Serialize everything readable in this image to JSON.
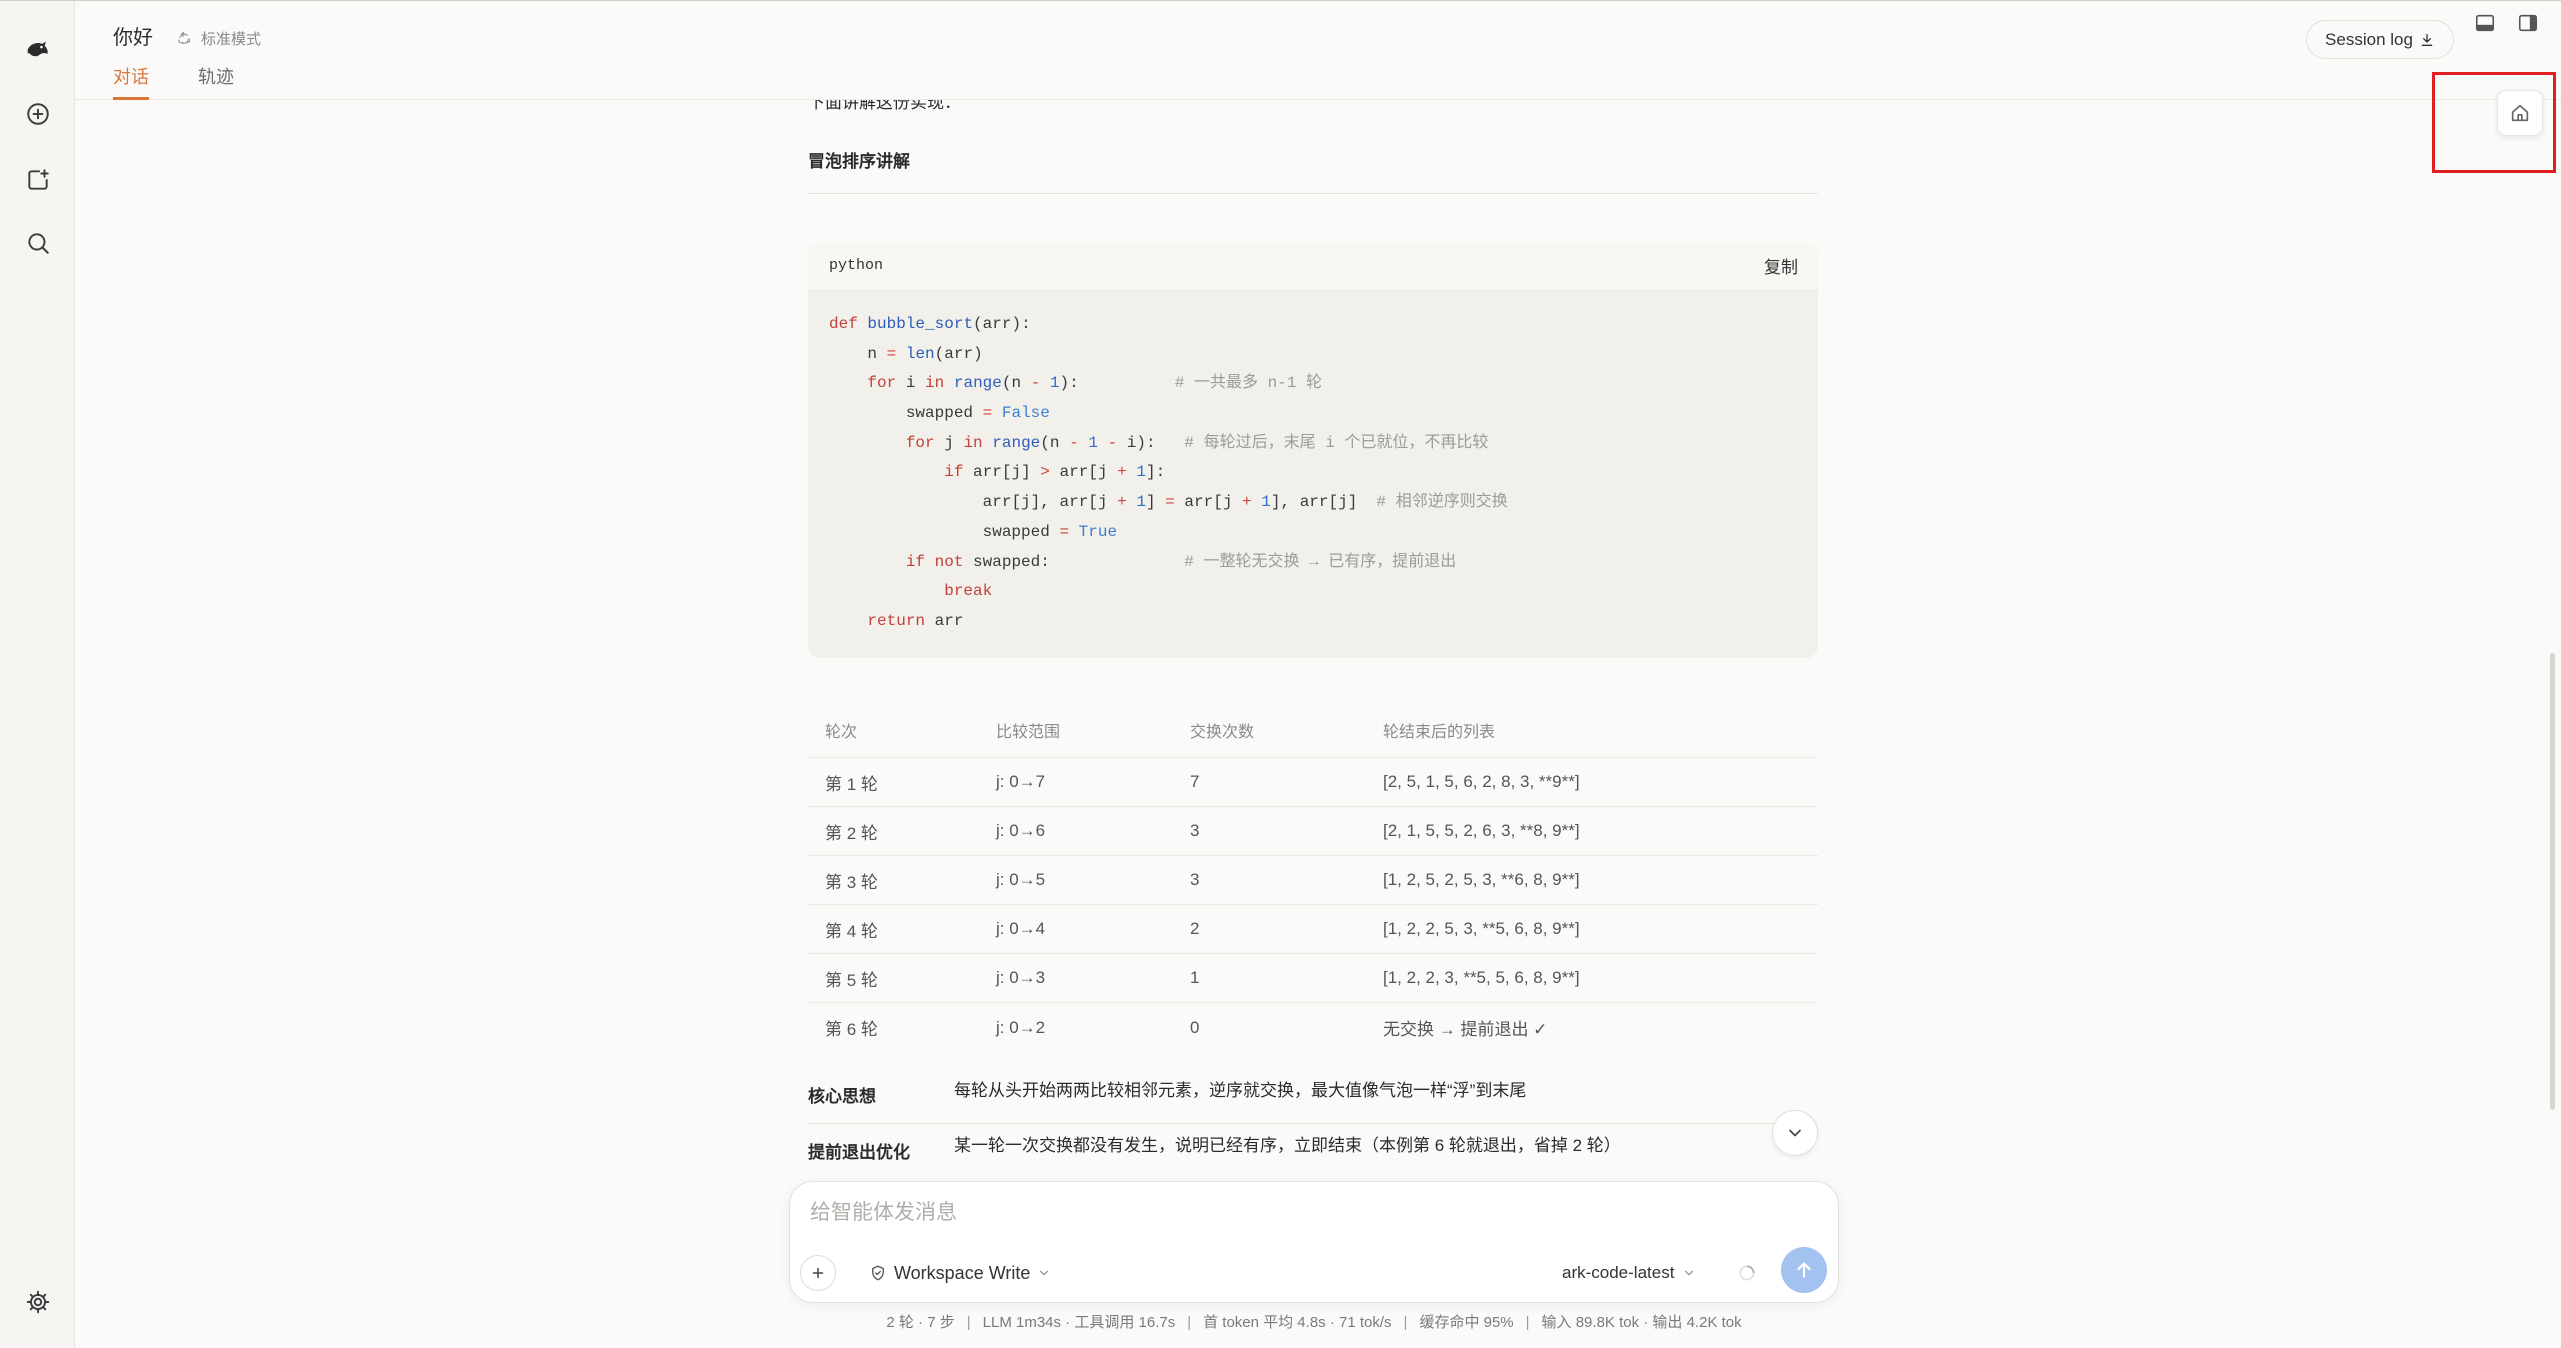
{
  "colors": {
    "accent": "#d9773b",
    "page_bg": "#fbfaf8",
    "sidebar_bg": "#f6f5f2",
    "code_bg": "#f2f0eb",
    "highlight_box": "#e02020",
    "send_button": "#a3c2f0"
  },
  "sidebar": {
    "icons": [
      "app-logo-icon",
      "plus-circle-icon",
      "new-project-icon",
      "search-icon",
      "settings-gear-icon"
    ]
  },
  "header": {
    "title": "你好",
    "mode_icon": "recycle-icon",
    "mode": "标准模式",
    "tabs": [
      {
        "label": "对话",
        "active": true
      },
      {
        "label": "轨迹",
        "active": false
      }
    ],
    "session_log": {
      "label": "Session log",
      "icon": "download-icon"
    },
    "layout_icons": [
      "panel-bottom-icon",
      "panel-right-icon"
    ]
  },
  "floating": {
    "home_icon": "home-icon",
    "scroll_down_icon": "chevron-down-icon"
  },
  "content": {
    "intro": "下面讲解这份实现：",
    "heading": "冒泡排序讲解",
    "code": {
      "language": "python",
      "copy_label": "复制",
      "lines": [
        "def bubble_sort(arr):",
        "    n = len(arr)",
        "    for i in range(n - 1):          # 一共最多 n-1 轮",
        "        swapped = False",
        "        for j in range(n - 1 - i):   # 每轮过后，末尾 i 个已就位，不再比较",
        "            if arr[j] > arr[j + 1]:",
        "                arr[j], arr[j + 1] = arr[j + 1], arr[j]  # 相邻逆序则交换",
        "                swapped = True",
        "        if not swapped:              # 一整轮无交换 → 已有序，提前退出",
        "            break",
        "    return arr"
      ]
    },
    "table": {
      "headers": [
        "轮次",
        "比较范围",
        "交换次数",
        "轮结束后的列表"
      ],
      "rows": [
        [
          "第 1 轮",
          "j: 0→7",
          "7",
          "[2, 5, 1, 5, 6, 2, 8, 3, **9**]"
        ],
        [
          "第 2 轮",
          "j: 0→6",
          "3",
          "[2, 1, 5, 5, 2, 6, 3, **8, 9**]"
        ],
        [
          "第 3 轮",
          "j: 0→5",
          "3",
          "[1, 2, 5, 2, 5, 3, **6, 8, 9**]"
        ],
        [
          "第 4 轮",
          "j: 0→4",
          "2",
          "[1, 2, 2, 5, 3, **5, 6, 8, 9**]"
        ],
        [
          "第 5 轮",
          "j: 0→3",
          "1",
          "[1, 2, 2, 3, **5, 5, 6, 8, 9**]"
        ],
        [
          "第 6 轮",
          "j: 0→2",
          "0",
          "无交换 → 提前退出 ✓"
        ]
      ]
    },
    "notes": [
      {
        "label": "核心思想",
        "text": "每轮从头开始两两比较相邻元素，逆序就交换，最大值像气泡一样“浮”到末尾"
      },
      {
        "label": "提前退出优化",
        "text": "某一轮一次交换都没有发生，说明已经有序，立即结束（本例第 6 轮就退出，省掉 2 轮）"
      }
    ]
  },
  "composer": {
    "placeholder": "给智能体发消息",
    "add_icon": "plus-icon",
    "permission_icon": "shield-icon",
    "permission": "Workspace Write",
    "model": "ark-code-latest",
    "send_icon": "arrow-up-icon"
  },
  "stats": {
    "separator": "|",
    "items": [
      "2 轮 · 7 步",
      "LLM 1m34s · 工具调用 16.7s",
      "首 token 平均 4.8s · 71 tok/s",
      "缓存命中 95%",
      "输入 89.8K tok · 输出 4.2K tok"
    ]
  }
}
